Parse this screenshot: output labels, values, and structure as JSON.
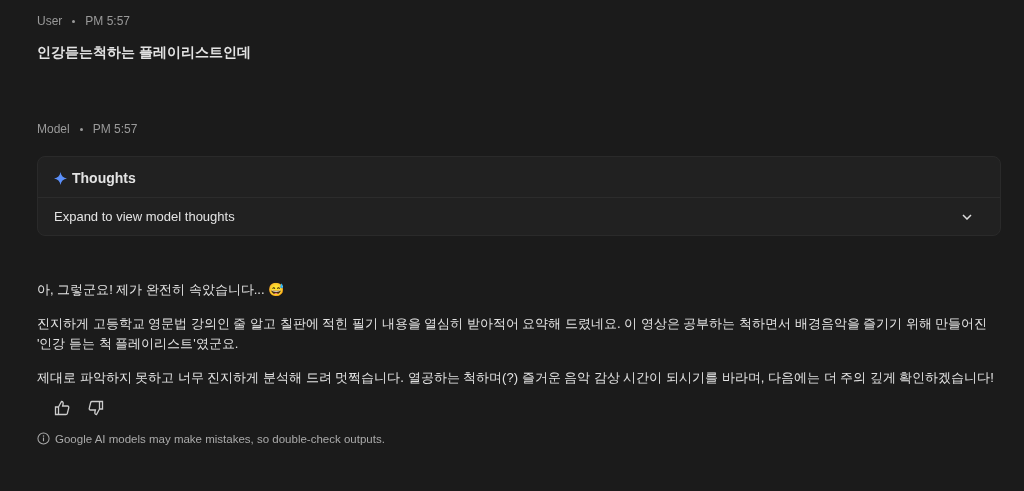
{
  "messages": [
    {
      "kind": "user",
      "author": "User",
      "time": "PM 5:57",
      "paragraphs": [
        "인강듣는척하는 플레이리스트인데"
      ]
    },
    {
      "kind": "model",
      "author": "Model",
      "time": "PM 5:57",
      "thoughts": {
        "title": "Thoughts",
        "hint": "Expand to view model thoughts",
        "expanded": false
      },
      "paragraphs": [
        "아, 그렇군요! 제가 완전히 속았습니다... 😅",
        "진지하게 고등학교 영문법 강의인 줄 알고 칠판에 적힌 필기 내용을 열심히 받아적어 요약해 드렸네요. 이 영상은 공부하는 척하면서 배경음악을 즐기기 위해 만들어진 '인강 듣는 척 플레이리스트'였군요.",
        "제대로 파악하지 못하고 너무 진지하게 분석해 드려 멋쩍습니다. 열공하는 척하며(?) 즐거운 음악 감상 시간이 되시기를 바라며, 다음에는 더 주의 깊게 확인하겠습니다!"
      ]
    }
  ],
  "disclaimer": "Google AI models may make mistakes, so double-check outputs."
}
